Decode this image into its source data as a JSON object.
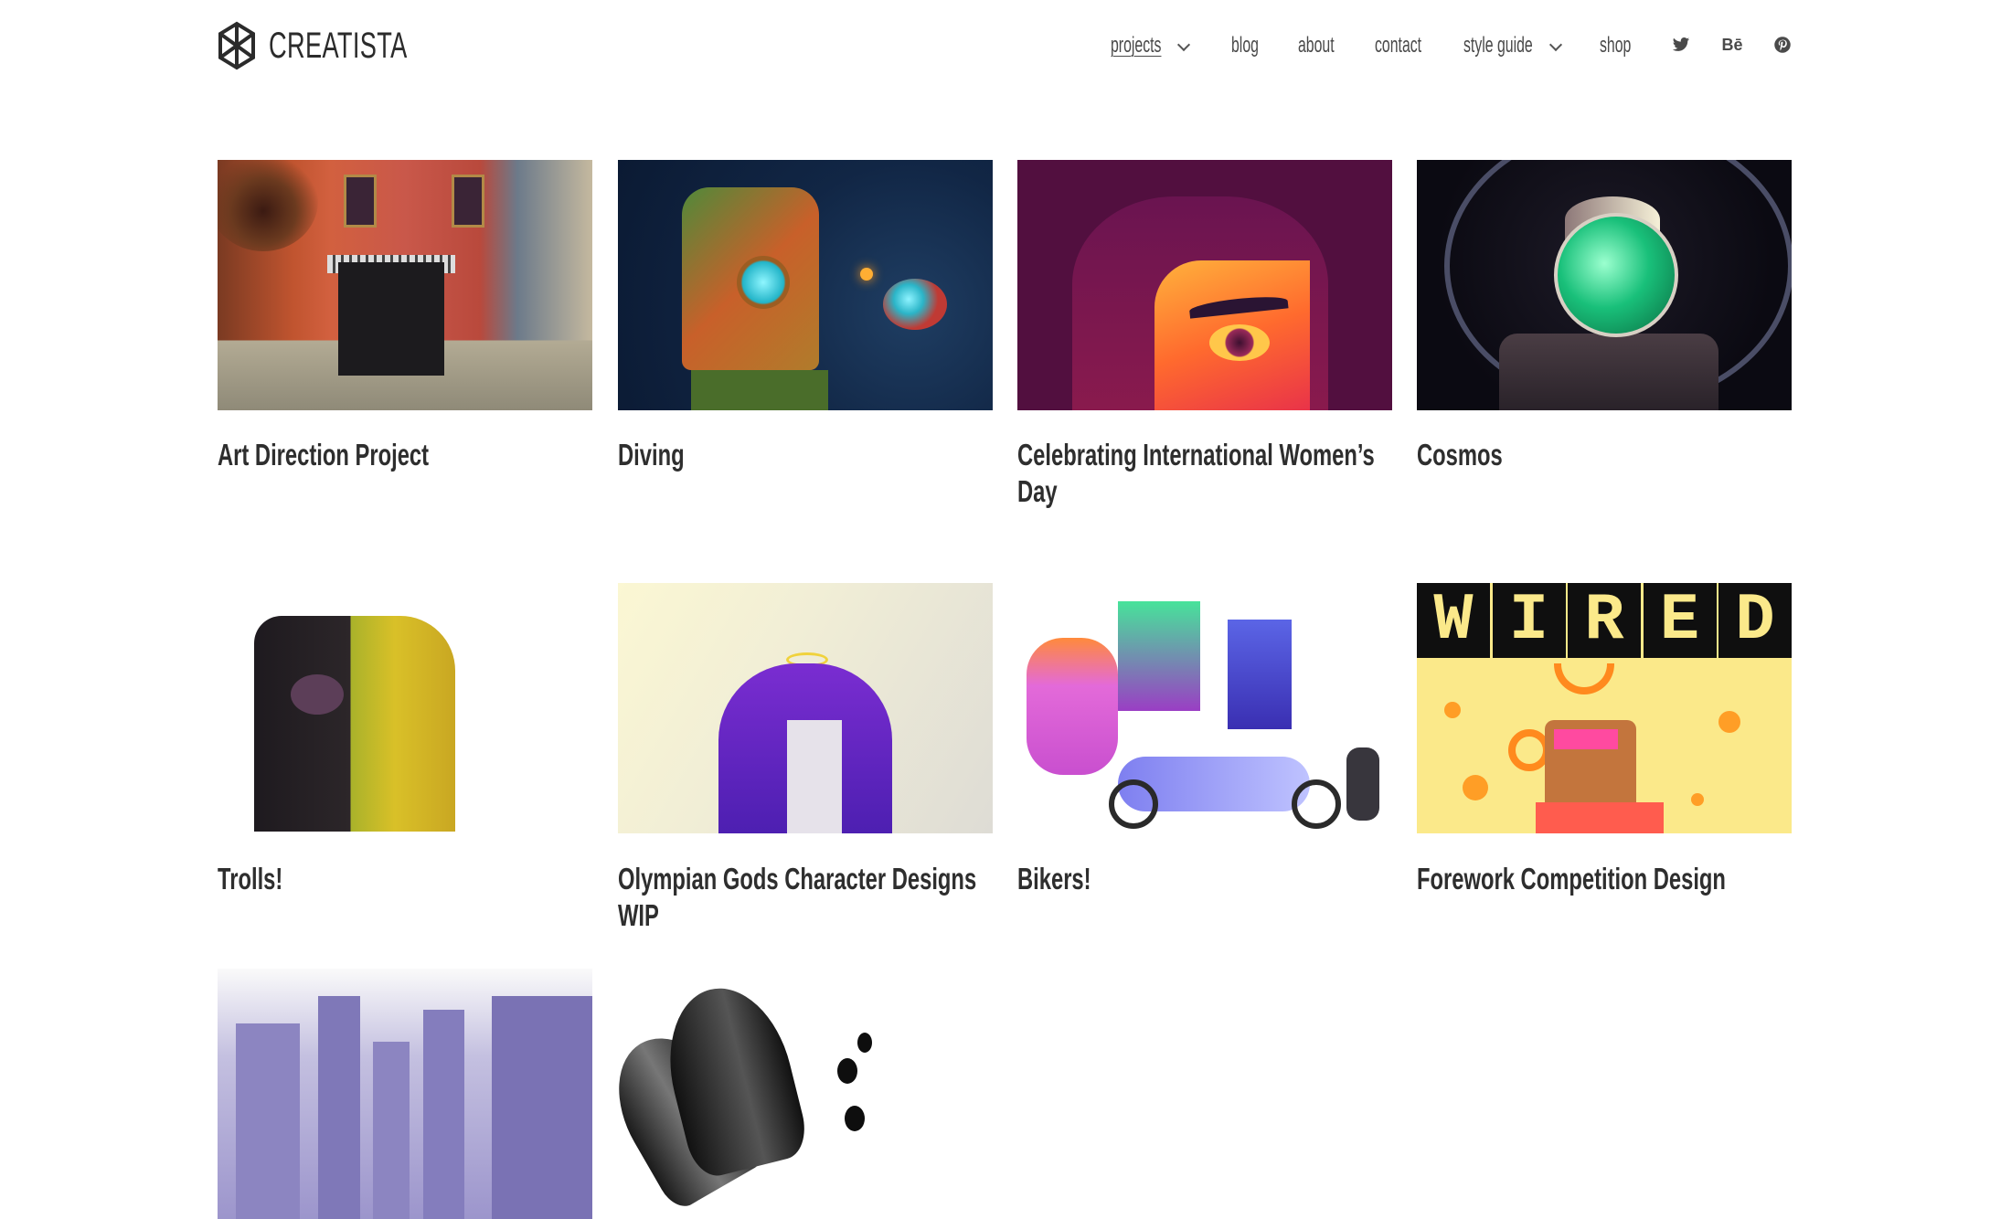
{
  "site": {
    "brand": "CREATISTA",
    "logo_icon": "hexagon-bowtie-logo-icon"
  },
  "nav": {
    "items": [
      {
        "label": "projects",
        "has_dropdown": true,
        "active": true
      },
      {
        "label": "blog",
        "has_dropdown": false,
        "active": false
      },
      {
        "label": "about",
        "has_dropdown": false,
        "active": false
      },
      {
        "label": "contact",
        "has_dropdown": false,
        "active": false
      },
      {
        "label": "style guide",
        "has_dropdown": true,
        "active": false
      },
      {
        "label": "shop",
        "has_dropdown": false,
        "active": false
      }
    ],
    "social": [
      {
        "name": "twitter",
        "icon": "twitter-icon"
      },
      {
        "name": "behance",
        "icon": "behance-icon",
        "glyph": "Bē"
      },
      {
        "name": "pinterest",
        "icon": "pinterest-icon"
      }
    ]
  },
  "projects": [
    {
      "title": "Art Direction Project",
      "art": "street-scene-illustration"
    },
    {
      "title": "Diving",
      "art": "diver-and-anglerfish-illustration"
    },
    {
      "title": "Celebrating International Women’s Day",
      "art": "woman-face-illustration"
    },
    {
      "title": "Cosmos",
      "art": "astronaut-illustration"
    },
    {
      "title": "Trolls!",
      "art": "troll-gorilla-illustration"
    },
    {
      "title": "Olympian Gods Character Designs WIP",
      "art": "goddess-archer-illustration"
    },
    {
      "title": "Bikers!",
      "art": "bikers-gang-illustration"
    },
    {
      "title": "Forework Competition Design",
      "art": "wired-cover-illustration",
      "cover_text": [
        "W",
        "I",
        "R",
        "E",
        "D"
      ]
    },
    {
      "title": "",
      "art": "city-skyline-illustration"
    },
    {
      "title": "",
      "art": "ink-brush-illustration"
    }
  ]
}
